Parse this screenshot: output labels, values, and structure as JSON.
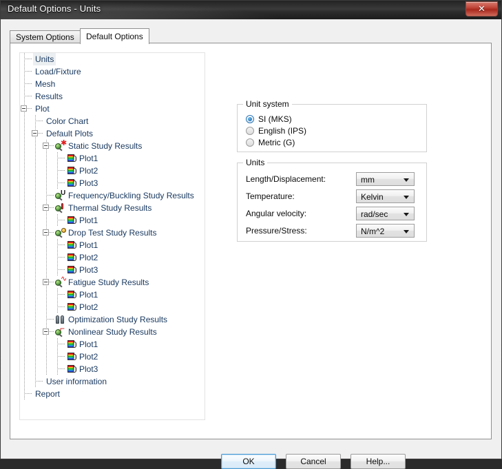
{
  "window": {
    "title": "Default Options - Units",
    "close_label": "✕"
  },
  "tabs": [
    {
      "label": "System Options",
      "active": false
    },
    {
      "label": "Default Options",
      "active": true
    }
  ],
  "tree": {
    "nodes": [
      {
        "label": "Units",
        "depth": 1,
        "icon": "none",
        "expander": "none",
        "selected": true
      },
      {
        "label": "Load/Fixture",
        "depth": 1,
        "icon": "none",
        "expander": "none",
        "selected": false
      },
      {
        "label": "Mesh",
        "depth": 1,
        "icon": "none",
        "expander": "none",
        "selected": false
      },
      {
        "label": "Results",
        "depth": 1,
        "icon": "none",
        "expander": "none",
        "selected": false
      },
      {
        "label": "Plot",
        "depth": 1,
        "icon": "none",
        "expander": "collapse",
        "selected": false
      },
      {
        "label": "Color Chart",
        "depth": 2,
        "icon": "none",
        "expander": "none",
        "selected": false
      },
      {
        "label": "Default Plots",
        "depth": 2,
        "icon": "none",
        "expander": "collapse",
        "selected": false
      },
      {
        "label": "Static Study Results",
        "depth": 3,
        "icon": "static",
        "expander": "collapse",
        "selected": false
      },
      {
        "label": "Plot1",
        "depth": 4,
        "icon": "plot",
        "expander": "none",
        "selected": false
      },
      {
        "label": "Plot2",
        "depth": 4,
        "icon": "plot",
        "expander": "none",
        "selected": false
      },
      {
        "label": "Plot3",
        "depth": 4,
        "icon": "plot",
        "expander": "none",
        "selected": false
      },
      {
        "label": "Frequency/Buckling Study Results",
        "depth": 3,
        "icon": "frequency",
        "expander": "none",
        "selected": false
      },
      {
        "label": "Thermal Study Results",
        "depth": 3,
        "icon": "thermal",
        "expander": "collapse",
        "selected": false
      },
      {
        "label": "Plot1",
        "depth": 4,
        "icon": "plot",
        "expander": "none",
        "selected": false
      },
      {
        "label": "Drop Test Study Results",
        "depth": 3,
        "icon": "drop",
        "expander": "collapse",
        "selected": false
      },
      {
        "label": "Plot1",
        "depth": 4,
        "icon": "plot",
        "expander": "none",
        "selected": false
      },
      {
        "label": "Plot2",
        "depth": 4,
        "icon": "plot",
        "expander": "none",
        "selected": false
      },
      {
        "label": "Plot3",
        "depth": 4,
        "icon": "plot",
        "expander": "none",
        "selected": false
      },
      {
        "label": "Fatigue Study Results",
        "depth": 3,
        "icon": "fatigue",
        "expander": "collapse",
        "selected": false
      },
      {
        "label": "Plot1",
        "depth": 4,
        "icon": "plot",
        "expander": "none",
        "selected": false
      },
      {
        "label": "Plot2",
        "depth": 4,
        "icon": "plot",
        "expander": "none",
        "selected": false
      },
      {
        "label": "Optimization Study Results",
        "depth": 3,
        "icon": "optimization",
        "expander": "none",
        "selected": false
      },
      {
        "label": "Nonlinear Study Results",
        "depth": 3,
        "icon": "nonlinear",
        "expander": "collapse",
        "selected": false
      },
      {
        "label": "Plot1",
        "depth": 4,
        "icon": "plot",
        "expander": "none",
        "selected": false
      },
      {
        "label": "Plot2",
        "depth": 4,
        "icon": "plot",
        "expander": "none",
        "selected": false
      },
      {
        "label": "Plot3",
        "depth": 4,
        "icon": "plot",
        "expander": "none",
        "selected": false
      },
      {
        "label": "User information",
        "depth": 2,
        "icon": "none",
        "expander": "none",
        "selected": false
      },
      {
        "label": "Report",
        "depth": 1,
        "icon": "none",
        "expander": "none",
        "selected": false
      }
    ]
  },
  "unit_system": {
    "legend": "Unit system",
    "options": [
      {
        "label": "SI (MKS)",
        "selected": true
      },
      {
        "label": "English (IPS)",
        "selected": false
      },
      {
        "label": "Metric (G)",
        "selected": false
      }
    ]
  },
  "units": {
    "legend": "Units",
    "fields": [
      {
        "label": "Length/Displacement:",
        "value": "mm"
      },
      {
        "label": "Temperature:",
        "value": "Kelvin"
      },
      {
        "label": "Angular velocity:",
        "value": "rad/sec"
      },
      {
        "label": "Pressure/Stress:",
        "value": "N/m^2"
      }
    ]
  },
  "buttons": {
    "ok": "OK",
    "cancel": "Cancel",
    "help": "Help..."
  },
  "colors": {
    "accent": "#2a74b5",
    "tree_text": "#17375e",
    "titlebar": "#2c2c2c",
    "close_red": "#c1463a"
  }
}
